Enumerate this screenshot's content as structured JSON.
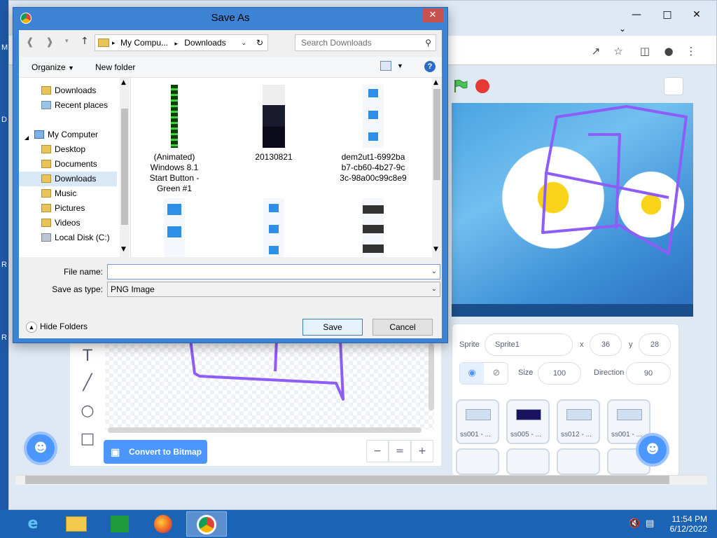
{
  "desktop": {
    "edge_letters": [
      "M",
      "D",
      "R",
      "R"
    ]
  },
  "chrome": {
    "window_controls": [
      "minimize",
      "maximize",
      "close"
    ],
    "toolbar_icons": [
      "share-icon",
      "star-icon",
      "sidepanel-icon",
      "profile-icon",
      "menu-icon"
    ]
  },
  "scratch": {
    "sprite_label": "Sprite",
    "sprite_name": "Sprite1",
    "x_label": "x",
    "x_value": "36",
    "y_label": "y",
    "y_value": "28",
    "size_label": "Size",
    "size_value": "100",
    "direction_label": "Direction",
    "direction_value": "90",
    "convert_button": "Convert to Bitmap",
    "zoom_out": "−",
    "zoom_reset": "=",
    "zoom_in": "+",
    "thumbnails": [
      {
        "caption": "ss001 - ..."
      },
      {
        "caption": "ss005 - ..."
      },
      {
        "caption": "ss012 - ..."
      },
      {
        "caption": "ss001 - ..."
      }
    ]
  },
  "dialog": {
    "title": "Save As",
    "breadcrumb_computer": "My Compu...",
    "breadcrumb_sep": "▸",
    "breadcrumb_folder": "Downloads",
    "search_placeholder": "Search Downloads",
    "organize_label": "Organize",
    "new_folder_label": "New folder",
    "nav_items": [
      {
        "label": "Downloads"
      },
      {
        "label": "Recent places"
      },
      {
        "label": "My Computer"
      },
      {
        "label": "Desktop"
      },
      {
        "label": "Documents"
      },
      {
        "label": "Downloads"
      },
      {
        "label": "Music"
      },
      {
        "label": "Pictures"
      },
      {
        "label": "Videos"
      },
      {
        "label": "Local Disk (C:)"
      }
    ],
    "files": [
      {
        "name_lines": [
          "(Animated)",
          "Windows 8.1",
          "Start Button -",
          "Green #1"
        ]
      },
      {
        "name_lines": [
          "20130821"
        ]
      },
      {
        "name_lines": [
          "dem2ut1-6992ba",
          "b7-cb60-4b27-9c",
          "3c-98a00c99c8e9"
        ]
      }
    ],
    "file_name_label": "File name:",
    "file_name_value": "",
    "save_type_label": "Save as type:",
    "save_type_value": "PNG Image",
    "hide_folders_label": "Hide Folders",
    "save_button": "Save",
    "cancel_button": "Cancel"
  },
  "taskbar": {
    "apps": [
      "internet-explorer-icon",
      "file-explorer-icon",
      "store-icon",
      "firefox-icon",
      "chrome-icon"
    ],
    "time": "11:54 PM",
    "date": "6/12/2022"
  }
}
